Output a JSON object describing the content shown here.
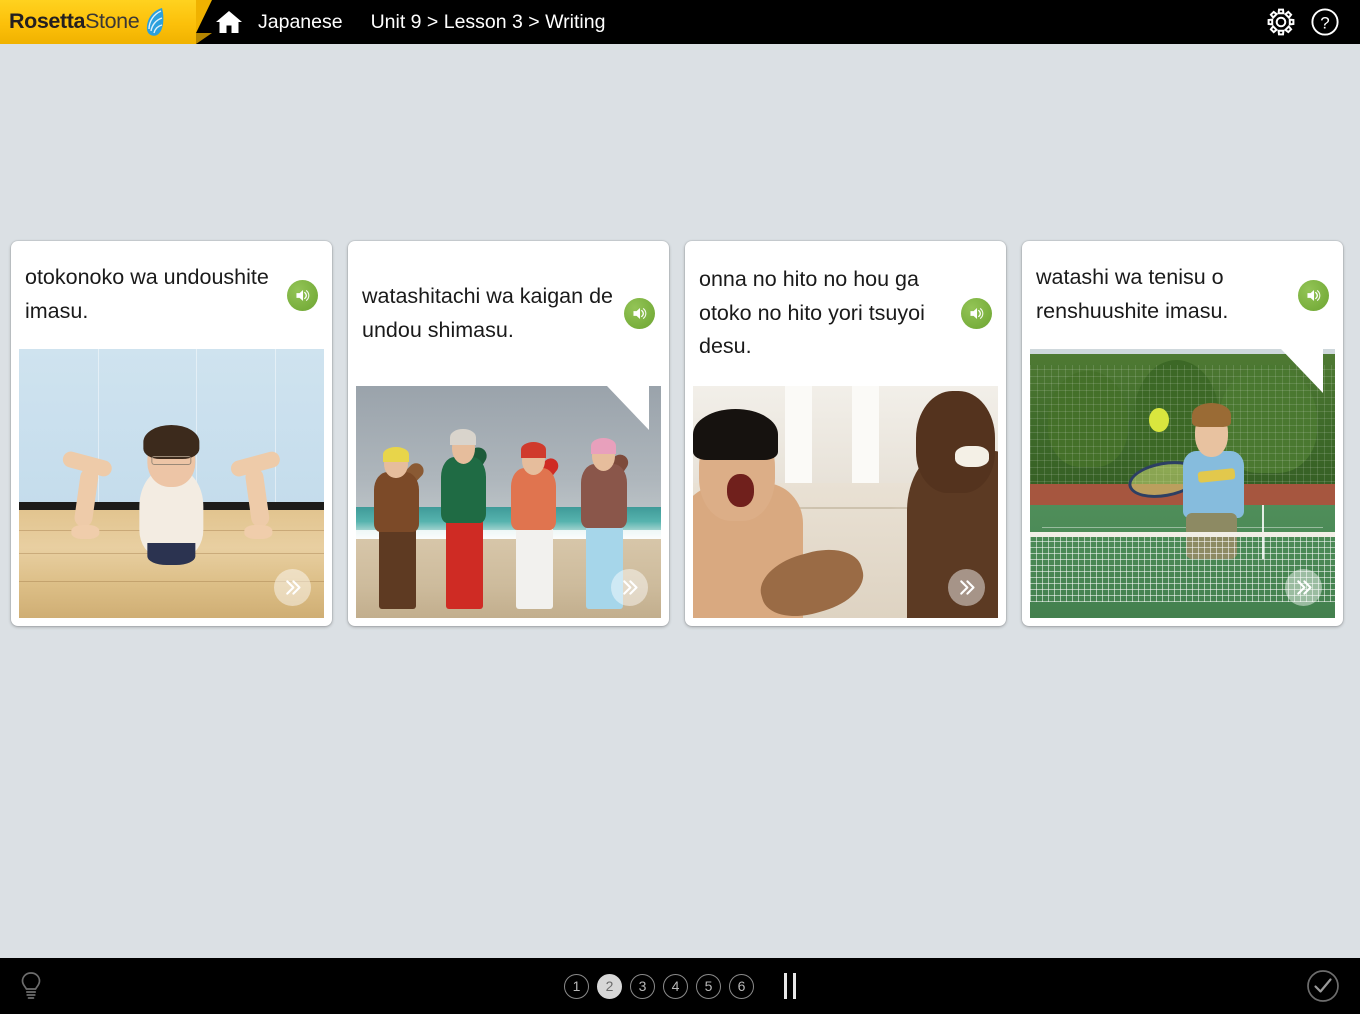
{
  "app": {
    "logo_primary": "Rosetta",
    "logo_secondary": "Stone",
    "logo_mark_icon": "rosetta-stone-leaf-icon"
  },
  "header": {
    "home_icon": "home-icon",
    "language": "Japanese",
    "breadcrumb": "Unit 9 > Lesson 3 > Writing",
    "settings_icon": "gear-icon",
    "help_icon": "question-mark-icon",
    "background_color": "#000000",
    "logo_background_color": "#fec60b"
  },
  "main": {
    "background_color": "#dbe0e4",
    "cards": [
      {
        "phrase": "otokonoko wa undoushite imasu.",
        "speaker_icon": "speaker-icon",
        "next_icon": "double-chevron-right-icon",
        "has_bubble_tail": false,
        "image_alt": "man doing push-ups on a gym floor"
      },
      {
        "phrase": "watashitachi wa kaigan de undou shimasu.",
        "speaker_icon": "speaker-icon",
        "next_icon": "double-chevron-right-icon",
        "has_bubble_tail": true,
        "image_alt": "four older people stretching on a beach"
      },
      {
        "phrase": "onna no hito no hou ga otoko no hito yori tsuyoi desu.",
        "speaker_icon": "speaker-icon",
        "next_icon": "double-chevron-right-icon",
        "has_bubble_tail": false,
        "image_alt": "woman and man arm wrestling"
      },
      {
        "phrase": "watashi wa tenisu o renshuushite imasu.",
        "speaker_icon": "speaker-icon",
        "next_icon": "double-chevron-right-icon",
        "has_bubble_tail": true,
        "image_alt": "boy playing tennis hitting a ball over a net"
      }
    ],
    "accent_color": "#7cb342"
  },
  "footer": {
    "hint_icon": "lightbulb-icon",
    "pages": [
      "1",
      "2",
      "3",
      "4",
      "5",
      "6"
    ],
    "active_page": "2",
    "pause_icon": "pause-bars-icon",
    "submit_icon": "checkmark-circle-icon",
    "background_color": "#000000"
  }
}
